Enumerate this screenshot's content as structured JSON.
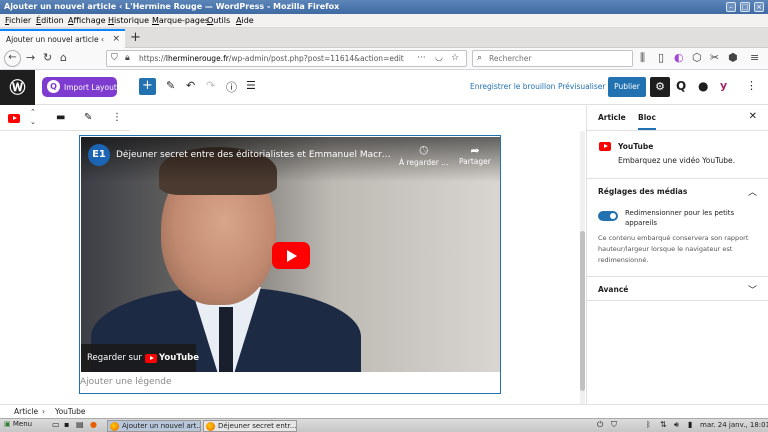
{
  "window": {
    "title": "Ajouter un nouvel article ‹ L'Hermine Rouge — WordPress - Mozilla Firefox"
  },
  "menubar": {
    "items": [
      "Fichier",
      "Édition",
      "Affichage",
      "Historique",
      "Marque-pages",
      "Outils",
      "Aide"
    ]
  },
  "browser": {
    "tab_label": "Ajouter un nouvel article ‹ L'Herm",
    "url_prefix": "https://",
    "url_domain": "lherminerouge.fr",
    "url_path": "/wp-admin/post.php?post=11614&action=edit",
    "search_placeholder": "Rechercher"
  },
  "wp_header": {
    "import_layout_label": "Import Layout",
    "save_draft_label": "Enregistrer le brouillon",
    "preview_label": "Prévisualiser",
    "publish_label": "Publier"
  },
  "embed": {
    "channel_logo_text": "E1",
    "video_title": "Déjeuner secret entre des éditorialistes et Emmanuel Macron...",
    "watch_later_label": "À regarder ...",
    "share_label": "Partager",
    "watch_on_label": "Regarder sur",
    "youtube_wordmark": "YouTube",
    "caption_placeholder": "Ajouter une légende"
  },
  "sidebar": {
    "tab_article": "Article",
    "tab_bloc": "Bloc",
    "block_name": "YouTube",
    "block_description": "Embarquez une vidéo YouTube.",
    "media_section_title": "Réglages des médias",
    "resize_toggle_label": "Redimensionner pour les petits appareils",
    "resize_toggle_on": true,
    "resize_help": "Ce contenu embarqué conservera son rapport hauteur/largeur lorsque le navigateur est redimensionné.",
    "advanced_section_title": "Avancé"
  },
  "breadcrumb": {
    "items": [
      "Article",
      "YouTube"
    ]
  },
  "taskbar": {
    "menu_label": "Menu",
    "task1": "Ajouter un nouvel art...",
    "task2": "Déjeuner secret entr...",
    "clock": "mar. 24 janv., 18:01"
  },
  "colors": {
    "wp_blue": "#2271b1",
    "import_purple": "#7e3bd0",
    "youtube_red": "#ff0000",
    "firefox_tab_accent": "#0a84ff"
  }
}
